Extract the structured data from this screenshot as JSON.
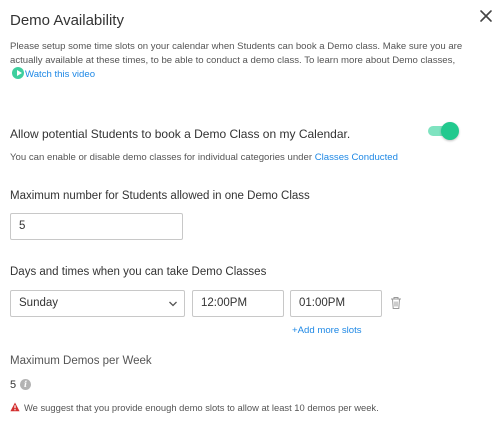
{
  "dialog": {
    "title": "Demo Availability",
    "intro_text": "Please setup some time slots on your calendar when Students can book a Demo class. Make sure you are actually available at these times, to be able to conduct a demo class. To learn more about Demo classes,",
    "watch_video_label": "Watch this video",
    "close_icon": "close-icon"
  },
  "allow": {
    "label": "Allow potential Students to book a Demo Class on my Calendar.",
    "enabled": true,
    "note_prefix": "You can enable or disable demo classes for individual categories under",
    "classes_conducted_link": "Classes Conducted"
  },
  "max_students": {
    "label": "Maximum number for Students allowed in one Demo Class",
    "value": "5"
  },
  "schedule": {
    "label": "Days and times when you can take Demo Classes",
    "slots": [
      {
        "day": "Sunday",
        "start": "12:00PM",
        "end": "01:00PM"
      }
    ],
    "add_more_label": "+Add more slots"
  },
  "max_demos": {
    "label": "Maximum Demos per Week",
    "value": "5"
  },
  "warning": {
    "text": "We suggest that you provide enough demo slots to allow at least 10 demos per week."
  },
  "colors": {
    "accent_link": "#1e88e5",
    "toggle_on": "#22c98e",
    "warning": "#d32f2f"
  }
}
